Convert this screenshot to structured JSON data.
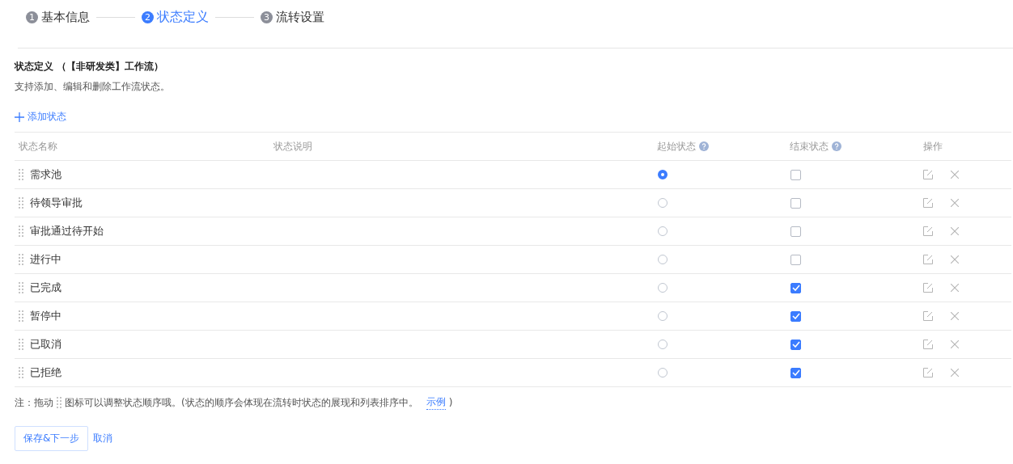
{
  "steps": [
    {
      "number": "1",
      "label": "基本信息",
      "selected": false
    },
    {
      "number": "2",
      "label": "状态定义",
      "selected": true
    },
    {
      "number": "3",
      "label": "流转设置",
      "selected": false
    }
  ],
  "section": {
    "title": "状态定义 （【非研发类】工作流）",
    "description": "支持添加、编辑和删除工作流状态。",
    "add_label": "添加状态"
  },
  "table": {
    "columns": [
      {
        "label": "状态名称",
        "kind": "plain"
      },
      {
        "label": "状态说明",
        "kind": "plain"
      },
      {
        "label": "起始状态",
        "kind": "help"
      },
      {
        "label": "结束状态",
        "kind": "help"
      },
      {
        "label": "操作",
        "kind": "plain"
      }
    ],
    "rows": [
      {
        "name": "需求池",
        "selected": true,
        "end": false
      },
      {
        "name": "待领导审批",
        "selected": false,
        "end": false
      },
      {
        "name": "审批通过待开始",
        "selected": false,
        "end": false
      },
      {
        "name": "进行中",
        "selected": false,
        "end": false
      },
      {
        "name": "已完成",
        "selected": false,
        "end": true
      },
      {
        "name": "暂停中",
        "selected": false,
        "end": true
      },
      {
        "name": "已取消",
        "selected": false,
        "end": true
      },
      {
        "name": "已拒绝",
        "selected": false,
        "end": true
      }
    ]
  },
  "note": {
    "prefix": "注：拖动",
    "text": "图标可以调整状态顺序哦。(状态的顺序会体现在流转时状态的展现和列表排序中。",
    "link": "示例",
    "suffix": ")"
  },
  "buttons": {
    "primary": "保存&下一步",
    "cancel": "取消"
  }
}
